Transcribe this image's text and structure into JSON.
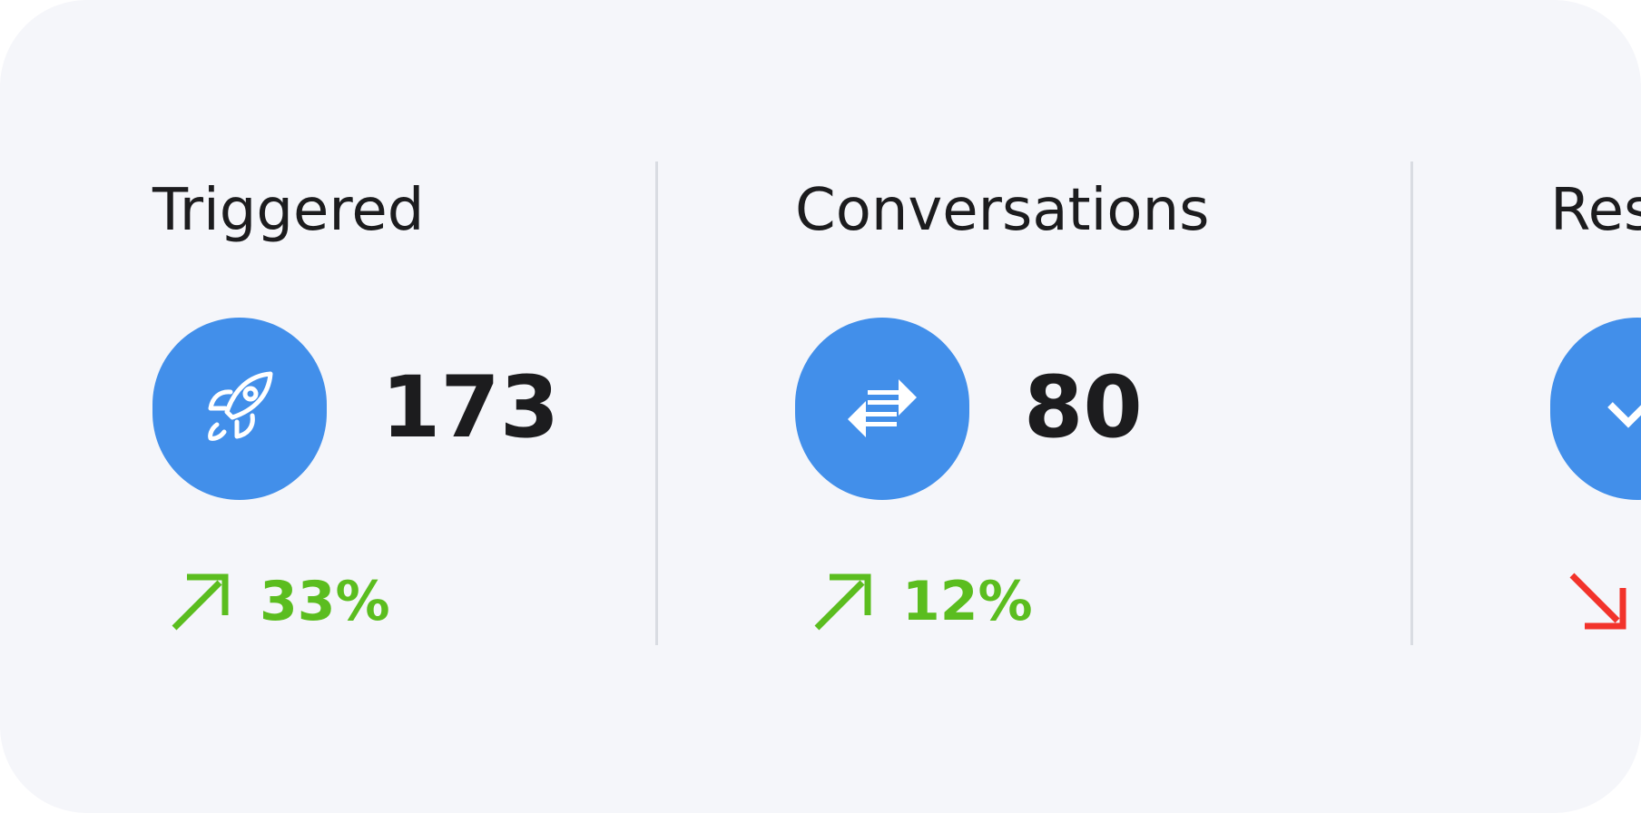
{
  "colors": {
    "card_background": "#f5f6fa",
    "icon_background": "#428fea",
    "trend_up": "#5bbd1f",
    "trend_down": "#f2332b",
    "divider": "#d9dce2",
    "text": "#1c1c1e"
  },
  "stats": [
    {
      "title": "Triggered",
      "icon": "rocket-icon",
      "value": "173",
      "trend": {
        "direction": "up",
        "value": "33%",
        "icon": "arrow-up-right-icon"
      }
    },
    {
      "title": "Conversations",
      "icon": "swap-arrows-icon",
      "value": "80",
      "trend": {
        "direction": "up",
        "value": "12%",
        "icon": "arrow-up-right-icon"
      }
    },
    {
      "title": "Res",
      "icon": "check-icon",
      "value": "",
      "trend": {
        "direction": "down",
        "value": "",
        "icon": "arrow-down-right-icon"
      }
    }
  ]
}
